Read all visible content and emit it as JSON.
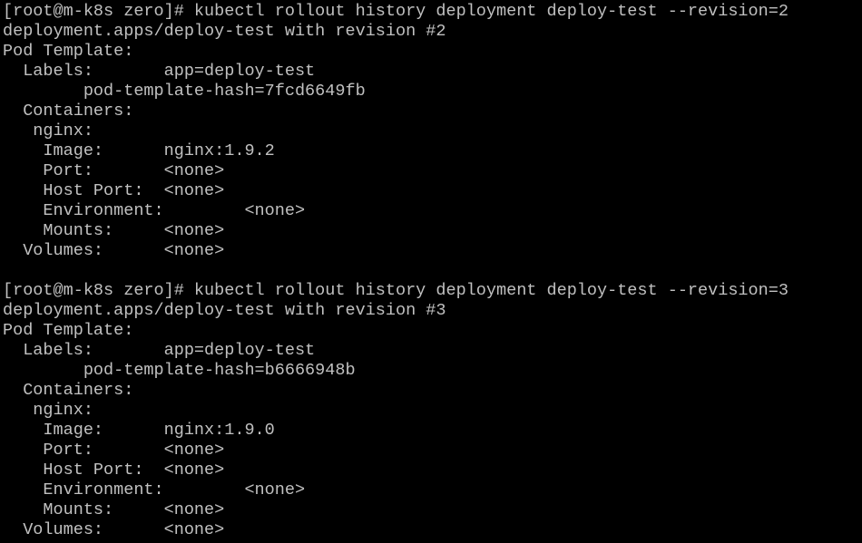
{
  "terminal": {
    "background": "#000000",
    "foreground": "#c0c0c0",
    "lines": [
      "[root@m-k8s zero]# kubectl rollout history deployment deploy-test --revision=2",
      "deployment.apps/deploy-test with revision #2",
      "Pod Template:",
      "  Labels:       app=deploy-test",
      "        pod-template-hash=7fcd6649fb",
      "  Containers:",
      "   nginx:",
      "    Image:      nginx:1.9.2",
      "    Port:       <none>",
      "    Host Port:  <none>",
      "    Environment:        <none>",
      "    Mounts:     <none>",
      "  Volumes:      <none>",
      "",
      "[root@m-k8s zero]# kubectl rollout history deployment deploy-test --revision=3",
      "deployment.apps/deploy-test with revision #3",
      "Pod Template:",
      "  Labels:       app=deploy-test",
      "        pod-template-hash=b6666948b",
      "  Containers:",
      "   nginx:",
      "    Image:      nginx:1.9.0",
      "    Port:       <none>",
      "    Host Port:  <none>",
      "    Environment:        <none>",
      "    Mounts:     <none>",
      "  Volumes:      <none>"
    ]
  }
}
